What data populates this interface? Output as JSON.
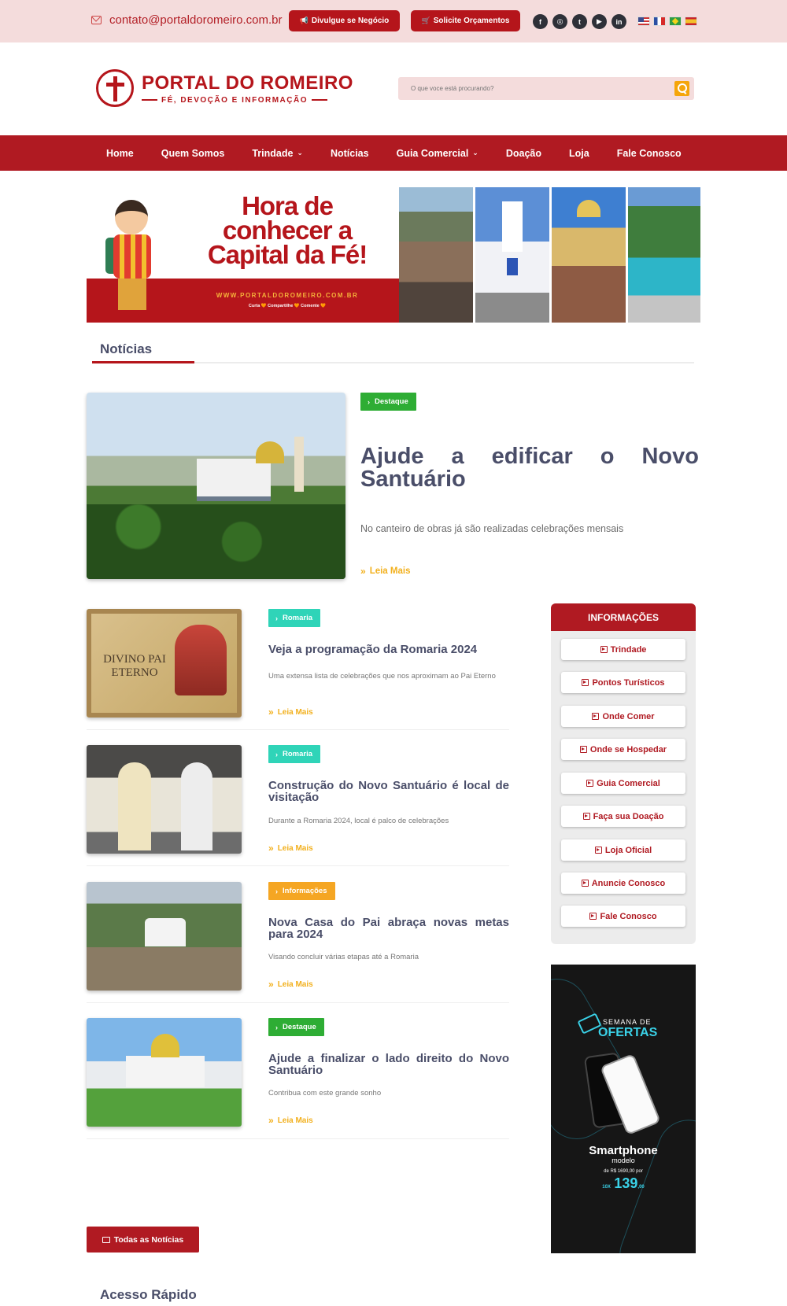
{
  "topbar": {
    "email": "contato@portaldoromeiro.com.br",
    "btn_divulgue": "Divulgue se Negócio",
    "btn_orcamentos": "Solicite Orçamentos",
    "socials": [
      "facebook",
      "instagram",
      "twitter",
      "youtube",
      "linkedin"
    ],
    "flags": [
      "en",
      "fr",
      "pt-br",
      "es"
    ]
  },
  "header": {
    "logo_title": "PORTAL DO ROMEIRO",
    "logo_subtitle": "FÉ, DEVOÇÃO E INFORMAÇÃO",
    "search_placeholder": "O que voce está procurando?"
  },
  "nav": {
    "items": [
      {
        "label": "Home"
      },
      {
        "label": "Quem Somos"
      },
      {
        "label": "Trindade",
        "dropdown": true
      },
      {
        "label": "Notícias"
      },
      {
        "label": "Guia Comercial",
        "dropdown": true
      },
      {
        "label": "Doação"
      },
      {
        "label": "Loja"
      },
      {
        "label": "Fale Conosco"
      }
    ]
  },
  "banner": {
    "headline_1": "Hora de",
    "headline_2": "conhecer a",
    "headline_3": "Capital da Fé!",
    "url": "WWW.PORTALDOROMEIRO.COM.BR",
    "cta": "Curta 🧡 Compartilhe 🧡 Comente 🧡"
  },
  "section": {
    "news_title": "Notícias",
    "quick_access": "Acesso Rápido",
    "all_news_button": "Todas as Notícias"
  },
  "featured": {
    "badge": "Destaque",
    "title": "Ajude a edificar o Novo Santuário",
    "description": "No canteiro de obras já são realizadas celebrações mensais",
    "read_more": "Leia Mais"
  },
  "news": [
    {
      "badge": "Romaria",
      "title": "Veja a programação da Romaria 2024",
      "description": "Uma extensa lista de celebrações que nos aproximam ao Pai Eterno",
      "read_more": "Leia Mais",
      "thumb_text": "DIVINO PAI ETERNO"
    },
    {
      "badge": "Romaria",
      "title": "Construção do Novo Santuário é local de visitação",
      "description": "Durante a Romaria 2024, local é palco de celebrações",
      "read_more": "Leia Mais"
    },
    {
      "badge": "Informações",
      "title": "Nova Casa do Pai abraça novas metas para 2024",
      "description": "Visando concluir várias etapas até a Romaria",
      "read_more": "Leia Mais"
    },
    {
      "badge": "Destaque",
      "title": "Ajude a finalizar o lado direito do Novo Santuário",
      "description": "Contribua com este grande sonho",
      "read_more": "Leia Mais"
    }
  ],
  "sidebar": {
    "title": "INFORMAÇÕES",
    "links": [
      "Trindade",
      "Pontos Turísticos",
      "Onde Comer",
      "Onde se Hospedar",
      "Guia Comercial",
      "Faça sua Doação",
      "Loja Oficial",
      "Anuncie Conosco",
      "Fale Conosco"
    ]
  },
  "ad": {
    "semana": "SEMANA DE",
    "ofertas": "OFERTAS",
    "product": "Smartphone",
    "model": "modelo",
    "from": "de R$ 1690,00 por",
    "installments": "10X",
    "price": "139",
    "cents": ",00"
  },
  "colors": {
    "brand_red": "#b01a22",
    "accent_yellow": "#f2b01d",
    "badge_green": "#2ead34",
    "badge_teal": "#2fd4b8",
    "badge_orange": "#f5a623",
    "title_slate": "#4a4e69"
  }
}
